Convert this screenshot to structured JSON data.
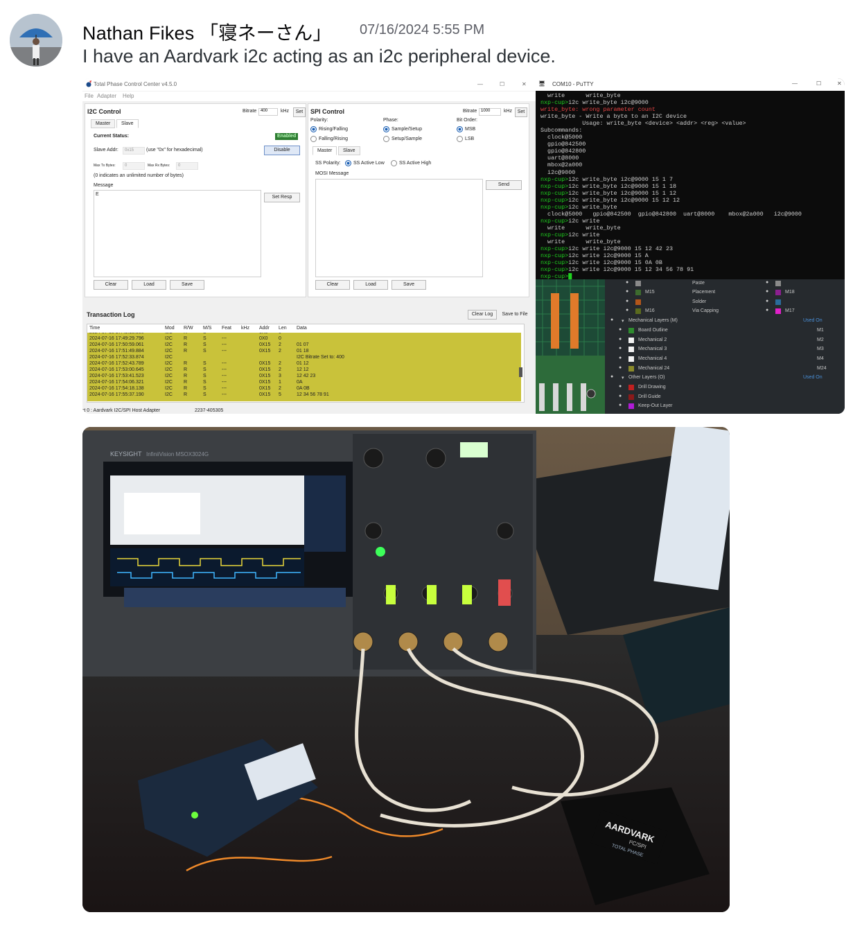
{
  "message": {
    "author": "Nathan Fikes 「寝ネーさん」",
    "timestamp": "07/16/2024 5:55 PM",
    "text": "I have an Aardvark i2c acting as an i2c peripheral device."
  },
  "totalphase": {
    "title": "Total Phase Control Center v4.5.0",
    "menu": [
      "File",
      "Adapter",
      "Help"
    ],
    "i2c": {
      "heading": "I2C Control",
      "bitrate_label": "Bitrate",
      "bitrate_value": "400",
      "khz": "kHz",
      "set": "Set",
      "tab_master": "Master",
      "tab_slave": "Slave",
      "status_label": "Current Status:",
      "status_value": "Enabled",
      "slave_addr_label": "Slave Addr:",
      "slave_addr_value": "0x15",
      "slave_addr_hint": "(use \"0x\" for hexadecimal)",
      "disable": "Disable",
      "max_tx_label": "Max Tx Bytes:",
      "max_tx_value": "0",
      "max_rx_label": "Max Rx Bytes:",
      "max_rx_value": "0",
      "unlimited_note": "(0 indicates an unlimited number of bytes)",
      "message_label": "Message",
      "message_value": "E",
      "set_resp": "Set Resp",
      "clear": "Clear",
      "load": "Load",
      "save": "Save"
    },
    "spi": {
      "heading": "SPI Control",
      "bitrate_label": "Bitrate",
      "bitrate_value": "1000",
      "khz": "kHz",
      "set": "Set",
      "polarity_label": "Polarity:",
      "polarity_opts": [
        "Rising/Falling",
        "Falling/Rising"
      ],
      "phase_label": "Phase:",
      "phase_opts": [
        "Sample/Setup",
        "Setup/Sample"
      ],
      "bitorder_label": "Bit Order:",
      "bitorder_opts": [
        "MSB",
        "LSB"
      ],
      "tab_master": "Master",
      "tab_slave": "Slave",
      "ss_polarity_label": "SS Polarity:",
      "ss_opts": [
        "SS Active Low",
        "SS Active High"
      ],
      "mosi_label": "MOSI Message",
      "send": "Send",
      "clear": "Clear",
      "load": "Load",
      "save": "Save"
    },
    "log": {
      "heading": "Transaction Log",
      "clear_log": "Clear Log",
      "save_to_file": "Save to File",
      "columns": [
        "Time",
        "Mod",
        "R/W",
        "M/S",
        "Feat",
        "kHz",
        "Addr",
        "Len",
        "Data"
      ],
      "rows": [
        [
          "2024-07-16 17:49:15.950",
          "I2C",
          "R",
          "S",
          "---",
          "",
          "0X0",
          "0",
          ""
        ],
        [
          "2024-07-16 17:49:29.796",
          "I2C",
          "R",
          "S",
          "---",
          "",
          "0X0",
          "0",
          ""
        ],
        [
          "2024-07-16 17:50:59.061",
          "I2C",
          "R",
          "S",
          "---",
          "",
          "0X15",
          "2",
          "01 07"
        ],
        [
          "2024-07-16 17:51:49.884",
          "I2C",
          "R",
          "S",
          "---",
          "",
          "0X15",
          "2",
          "01 18"
        ],
        [
          "2024-07-16 17:52:33.874",
          "I2C",
          "",
          "",
          "",
          "",
          "",
          "",
          "I2C Bitrate Set to: 400"
        ],
        [
          "2024-07-16 17:52:43.789",
          "I2C",
          "R",
          "S",
          "---",
          "",
          "0X15",
          "2",
          "01 12"
        ],
        [
          "2024-07-16 17:53:00.645",
          "I2C",
          "R",
          "S",
          "---",
          "",
          "0X15",
          "2",
          "12 12"
        ],
        [
          "2024-07-16 17:53:41.523",
          "I2C",
          "R",
          "S",
          "---",
          "",
          "0X15",
          "3",
          "12 42 23"
        ],
        [
          "2024-07-16 17:54:06.321",
          "I2C",
          "R",
          "S",
          "---",
          "",
          "0X15",
          "1",
          "0A"
        ],
        [
          "2024-07-16 17:54:18.138",
          "I2C",
          "R",
          "S",
          "---",
          "",
          "0X15",
          "2",
          "0A 0B"
        ],
        [
          "2024-07-16 17:55:37.190",
          "I2C",
          "R",
          "S",
          "---",
          "",
          "0X15",
          "5",
          "12 34 56 78 91"
        ]
      ]
    },
    "statusbar": {
      "port": "rt 0 : Aardvark I2C/SPI Host Adapter",
      "serial": "2237-405305"
    }
  },
  "putty": {
    "title": "COM10 - PuTTY",
    "lines": [
      {
        "c": "w",
        "t": "  write      write_byte"
      },
      {
        "c": "g",
        "p": "nxp-cup>",
        "t": "i2c write_byte i2c@9000"
      },
      {
        "c": "r",
        "t": "write_byte: wrong parameter count"
      },
      {
        "c": "w",
        "t": "write_byte - Write a byte to an I2C device"
      },
      {
        "c": "w",
        "t": "            Usage: write_byte <device> <addr> <reg> <value>"
      },
      {
        "c": "w",
        "t": "Subcommands:"
      },
      {
        "c": "w",
        "t": "  clock@5000"
      },
      {
        "c": "w",
        "t": "  gpio@842500"
      },
      {
        "c": "w",
        "t": "  gpio@842800"
      },
      {
        "c": "w",
        "t": "  uart@8000"
      },
      {
        "c": "w",
        "t": "  mbox@2a000"
      },
      {
        "c": "w",
        "t": "  i2c@9000"
      },
      {
        "c": "g",
        "p": "nxp-cup>",
        "t": "i2c write_byte i2c@9000 15 1 7"
      },
      {
        "c": "g",
        "p": "nxp-cup>",
        "t": "i2c write_byte i2c@9000 15 1 18"
      },
      {
        "c": "g",
        "p": "nxp-cup>",
        "t": "i2c write_byte i2c@9000 15 1 12"
      },
      {
        "c": "g",
        "p": "nxp-cup>",
        "t": "i2c write_byte i2c@9000 15 12 12"
      },
      {
        "c": "g",
        "p": "nxp-cup>",
        "t": "i2c write_byte"
      },
      {
        "c": "w",
        "t": "  clock@5000   gpio@842500  gpio@842800  uart@8000    mbox@2a000   i2c@9000"
      },
      {
        "c": "g",
        "p": "nxp-cup>",
        "t": "i2c write"
      },
      {
        "c": "w",
        "t": "  write      write_byte"
      },
      {
        "c": "g",
        "p": "nxp-cup>",
        "t": "i2c write"
      },
      {
        "c": "w",
        "t": "  write      write_byte"
      },
      {
        "c": "g",
        "p": "nxp-cup>",
        "t": "i2c write i2c@9000 15 12 42 23"
      },
      {
        "c": "g",
        "p": "nxp-cup>",
        "t": "i2c write i2c@9000 15 A"
      },
      {
        "c": "g",
        "p": "nxp-cup>",
        "t": "i2c write i2c@9000 15 0A 0B"
      },
      {
        "c": "g",
        "p": "nxp-cup>",
        "t": "i2c write i2c@9000 15 12 34 56 78 91"
      },
      {
        "c": "g",
        "p": "nxp-cup>",
        "t": ""
      }
    ]
  },
  "layers": {
    "rows": [
      {
        "eye": true,
        "name": "M15",
        "color": "#3d6b2e",
        "name2": "Placement",
        "eye2": true,
        "m2": "M18",
        "color2": "#8b1f8f"
      },
      {
        "eye": true,
        "name": "",
        "color": "#b3561a",
        "name2": "Solder",
        "eye2": true,
        "m2": "",
        "color2": "#2a6c9b"
      },
      {
        "eye": true,
        "name": "M16",
        "color": "#5b6b1e",
        "name2": "Via Capping",
        "eye2": true,
        "m2": "M17",
        "color2": "#e021c9"
      }
    ],
    "paste": "Paste",
    "groups": [
      {
        "name": "Mechanical Layers (M)",
        "used": "Used On",
        "items": [
          {
            "name": "Board Outline",
            "code": "M1",
            "color": "#2e8b2e"
          },
          {
            "name": "Mechanical 2",
            "code": "M2",
            "color": "#f2f2f2"
          },
          {
            "name": "Mechanical 3",
            "code": "M3",
            "color": "#f2f2f2"
          },
          {
            "name": "Mechanical 4",
            "code": "M4",
            "color": "#f2f2f2"
          },
          {
            "name": "Mechanical 24",
            "code": "M24",
            "color": "#8a8a2a"
          }
        ]
      },
      {
        "name": "Other Layers (O)",
        "used": "Used On",
        "items": [
          {
            "name": "Drill Drawing",
            "code": "",
            "color": "#c02020"
          },
          {
            "name": "Drill Guide",
            "code": "",
            "color": "#8b1a1a"
          },
          {
            "name": "Keep-Out Layer",
            "code": "",
            "color": "#b01cd6"
          }
        ]
      }
    ]
  },
  "photo": {
    "brand": "KEYSIGHT",
    "model": "InfiniiVision MSOX3024G",
    "product": "AARDVARK",
    "product_sub": "I²C/SPI",
    "maker": "TOTAL PHASE"
  },
  "colors": {
    "log_highlight": "#c9c23a",
    "term_green": "#1fd31f",
    "term_red": "#e84545",
    "enabled_green": "#2e7d32"
  }
}
